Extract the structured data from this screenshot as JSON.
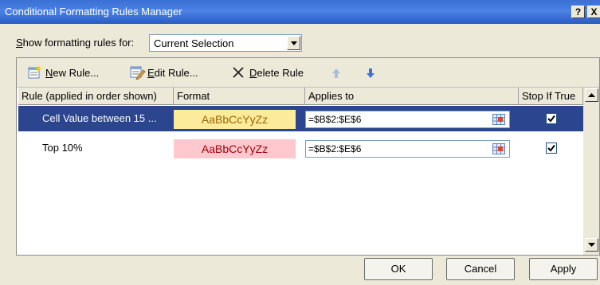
{
  "window": {
    "title": "Conditional Formatting Rules Manager",
    "help_label": "?",
    "close_label": "X"
  },
  "show_rules": {
    "label_rest": "how formatting rules for:",
    "label_accel": "S",
    "selected_value": "Current Selection"
  },
  "toolbar": {
    "new_rule": {
      "accel": "N",
      "rest": "ew Rule..."
    },
    "edit_rule": {
      "accel": "E",
      "rest": "dit Rule..."
    },
    "delete_rule": {
      "accel": "D",
      "rest": "elete Rule"
    }
  },
  "table": {
    "headers": [
      "Rule (applied in order shown)",
      "Format",
      "Applies to",
      "Stop If True"
    ],
    "rows": [
      {
        "rule": "Cell Value between 15 ...",
        "format_preview": "AaBbCcYyZz",
        "applies_to": "=$B$2:$E$6",
        "stop_if_true": true,
        "selected": true
      },
      {
        "rule": "Top 10%",
        "format_preview": "AaBbCcYyZz",
        "applies_to": "=$B$2:$E$6",
        "stop_if_true": true,
        "selected": false
      }
    ]
  },
  "buttons": {
    "ok": "OK",
    "cancel": "Cancel",
    "apply": "Apply"
  },
  "colors": {
    "selection": "#2b468e",
    "format1_fill": "#fdeb9c",
    "format1_text": "#9c6500",
    "format2_fill": "#ffc7ce",
    "format2_text": "#9c0006"
  },
  "icons": [
    "new-rule-icon",
    "edit-rule-icon",
    "delete-x-icon",
    "move-up-icon",
    "move-down-icon",
    "range-picker-icon",
    "dropdown-arrow-icon",
    "scroll-up-icon",
    "scroll-down-icon",
    "checkmark-icon"
  ]
}
